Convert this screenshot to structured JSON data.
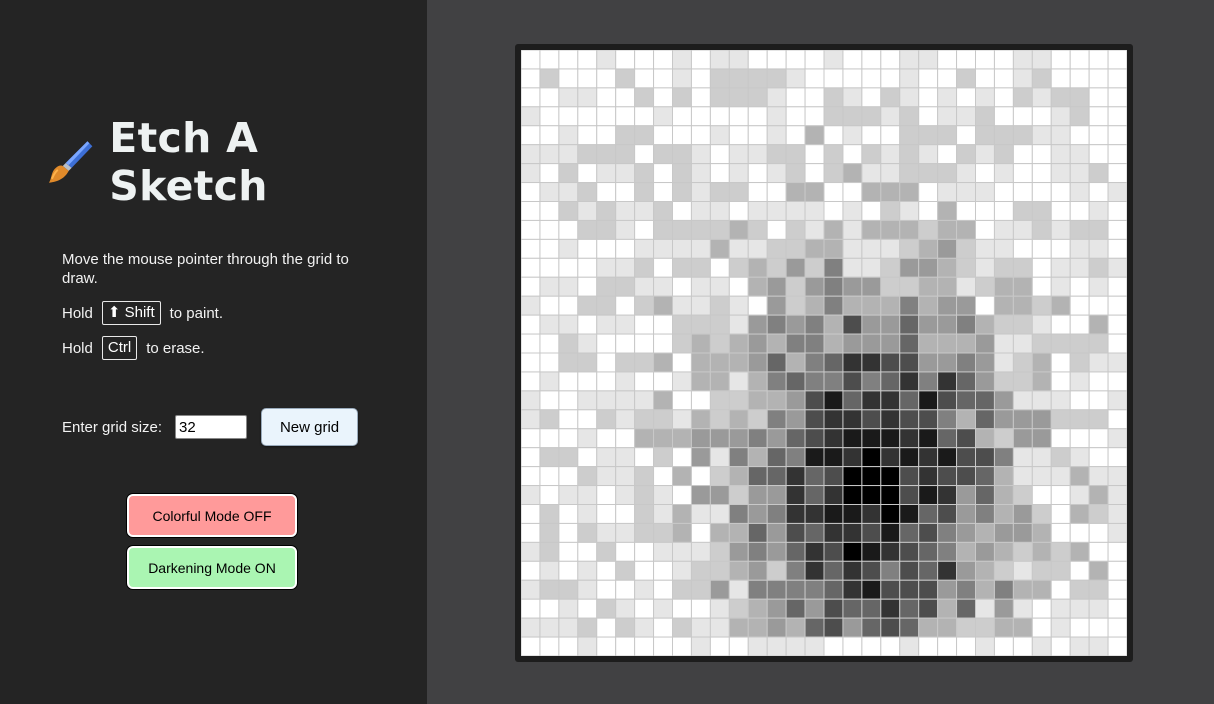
{
  "app": {
    "title": "Etch A Sketch",
    "title_icon": "paintbrush-icon"
  },
  "instructions": {
    "move": "Move the mouse pointer through the grid to draw.",
    "hold_word": "Hold",
    "shift_key": "⬆ Shift",
    "shift_action": "to paint.",
    "ctrl_key": "Ctrl",
    "ctrl_action": "to erase."
  },
  "controls": {
    "grid_size_label": "Enter grid size:",
    "grid_size_value": "32",
    "new_grid_label": "New grid",
    "colorful_mode_label": "Colorful Mode OFF",
    "darkening_mode_label": "Darkening Mode ON"
  },
  "colors": {
    "sidebar_bg": "#242424",
    "main_bg": "#414143",
    "colorful_off": "#ff9a9a",
    "darkening_on": "#aaf5b2",
    "cell_border": "#c8c8c8"
  },
  "grid": {
    "size": 32,
    "shade_levels": [
      "#ffffff",
      "#e6e6e6",
      "#cdcdcd",
      "#b3b3b3",
      "#9a9a9a",
      "#808080",
      "#666666",
      "#4d4d4d",
      "#333333",
      "#1a1a1a",
      "#000000"
    ]
  }
}
